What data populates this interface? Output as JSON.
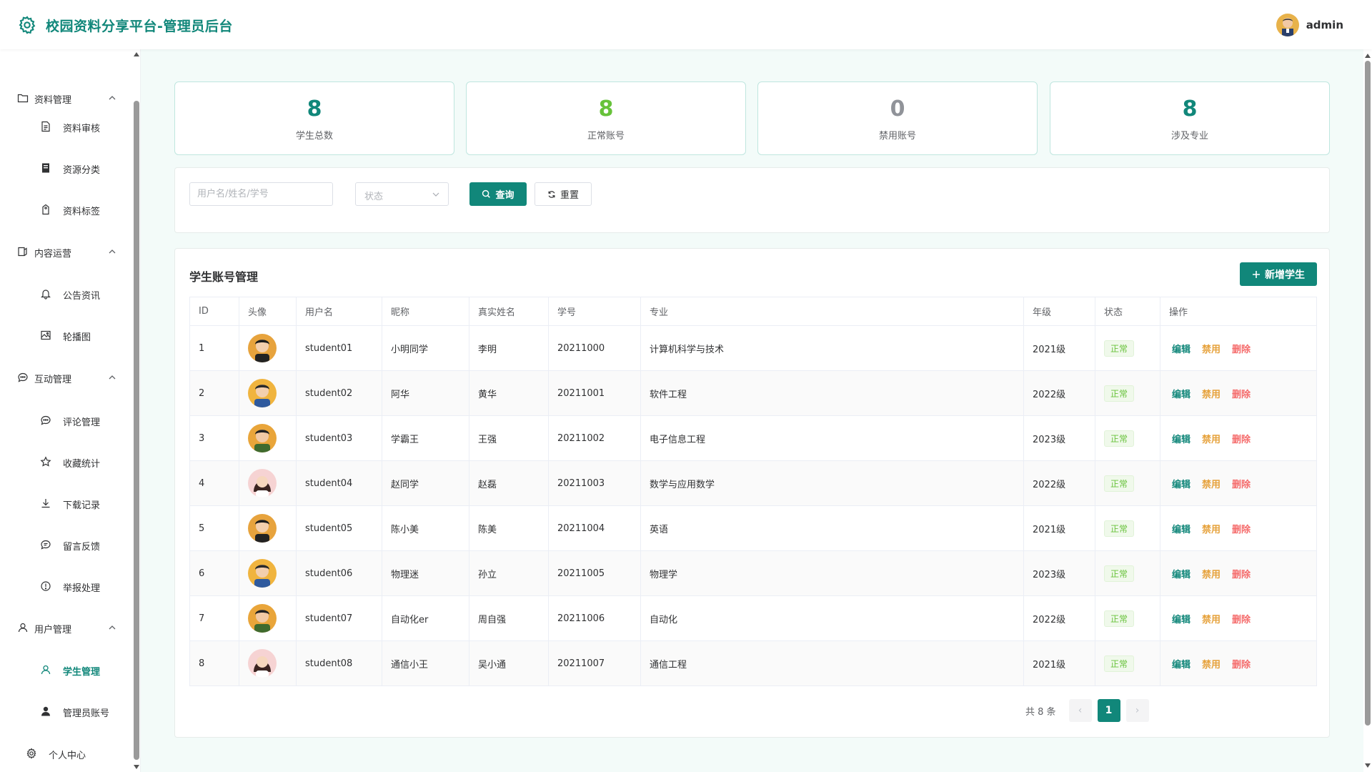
{
  "header": {
    "title": "校园资料分享平台-管理员后台",
    "username": "admin"
  },
  "sidebar": {
    "groups": [
      {
        "label": "资料管理",
        "icon": "folder-icon",
        "items": [
          {
            "label": "资料审核",
            "icon": "document-icon"
          },
          {
            "label": "资源分类",
            "icon": "notebook-icon"
          },
          {
            "label": "资料标签",
            "icon": "tag-icon"
          }
        ]
      },
      {
        "label": "内容运营",
        "icon": "content-icon",
        "items": [
          {
            "label": "公告资讯",
            "icon": "bell-icon"
          },
          {
            "label": "轮播图",
            "icon": "picture-icon"
          }
        ]
      },
      {
        "label": "互动管理",
        "icon": "chat-icon",
        "items": [
          {
            "label": "评论管理",
            "icon": "comment-icon"
          },
          {
            "label": "收藏统计",
            "icon": "star-icon"
          },
          {
            "label": "下载记录",
            "icon": "download-icon"
          },
          {
            "label": "留言反馈",
            "icon": "message-icon"
          },
          {
            "label": "举报处理",
            "icon": "warning-icon"
          }
        ]
      },
      {
        "label": "用户管理",
        "icon": "user-icon",
        "items": [
          {
            "label": "学生管理",
            "icon": "user-outline-icon",
            "active": true
          },
          {
            "label": "管理员账号",
            "icon": "user-solid-icon"
          }
        ]
      }
    ],
    "personal": {
      "label": "个人中心",
      "icon": "gear-icon"
    }
  },
  "stats": [
    {
      "value": "8",
      "label": "学生总数",
      "color": "#11877a"
    },
    {
      "value": "8",
      "label": "正常账号",
      "color": "#67c23a"
    },
    {
      "value": "0",
      "label": "禁用账号",
      "color": "#909399"
    },
    {
      "value": "8",
      "label": "涉及专业",
      "color": "#11877a"
    }
  ],
  "filter": {
    "keyword_placeholder": "用户名/姓名/学号",
    "status_placeholder": "状态",
    "query_label": "查询",
    "reset_label": "重置"
  },
  "table": {
    "title": "学生账号管理",
    "add_label": "新增学生",
    "columns": [
      "ID",
      "头像",
      "用户名",
      "昵称",
      "真实姓名",
      "学号",
      "专业",
      "年级",
      "状态",
      "操作"
    ],
    "actions": {
      "edit": "编辑",
      "disable": "禁用",
      "delete": "删除"
    },
    "rows": [
      {
        "id": "1",
        "username": "student01",
        "nickname": "小明同学",
        "realname": "李明",
        "sno": "20211000",
        "major": "计算机科学与技术",
        "grade": "2021级",
        "status": "正常",
        "avatar": "male"
      },
      {
        "id": "2",
        "username": "student02",
        "nickname": "阿华",
        "realname": "黄华",
        "sno": "20211001",
        "major": "软件工程",
        "grade": "2022级",
        "status": "正常",
        "avatar": "male-blue"
      },
      {
        "id": "3",
        "username": "student03",
        "nickname": "学霸王",
        "realname": "王强",
        "sno": "20211002",
        "major": "电子信息工程",
        "grade": "2023级",
        "status": "正常",
        "avatar": "male-green"
      },
      {
        "id": "4",
        "username": "student04",
        "nickname": "赵同学",
        "realname": "赵磊",
        "sno": "20211003",
        "major": "数学与应用数学",
        "grade": "2022级",
        "status": "正常",
        "avatar": "female"
      },
      {
        "id": "5",
        "username": "student05",
        "nickname": "陈小美",
        "realname": "陈美",
        "sno": "20211004",
        "major": "英语",
        "grade": "2021级",
        "status": "正常",
        "avatar": "male"
      },
      {
        "id": "6",
        "username": "student06",
        "nickname": "物理迷",
        "realname": "孙立",
        "sno": "20211005",
        "major": "物理学",
        "grade": "2023级",
        "status": "正常",
        "avatar": "male-blue"
      },
      {
        "id": "7",
        "username": "student07",
        "nickname": "自动化er",
        "realname": "周自强",
        "sno": "20211006",
        "major": "自动化",
        "grade": "2022级",
        "status": "正常",
        "avatar": "male-green"
      },
      {
        "id": "8",
        "username": "student08",
        "nickname": "通信小王",
        "realname": "吴小通",
        "sno": "20211007",
        "major": "通信工程",
        "grade": "2021级",
        "status": "正常",
        "avatar": "female"
      }
    ]
  },
  "pagination": {
    "total_text": "共 8 条",
    "current_page": "1",
    "prev": "‹",
    "next": "›"
  }
}
